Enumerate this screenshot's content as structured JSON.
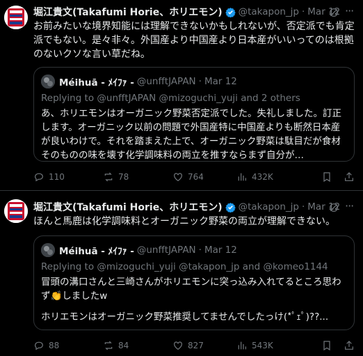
{
  "tweets": [
    {
      "author_name": "堀江貴文(Takafumi Horie、ホリエモン)",
      "handle": "@takapon_jp",
      "date": "Mar 12",
      "text": "お前みたいな境界知能には理解できないかもしれないが、否定派でも肯定派でもない。是々非々。外国産より中国産より日本産がいいってのは根拠のないクソな言い草だね。",
      "quote": {
        "author_name": "Méihuā - ﾒｲﾌｧ -",
        "handle": "@unfftJAPAN",
        "date": "Mar 12",
        "replying_prefix": "Replying to",
        "replying_to": "@unfftJAPAN @mizoguchi_yuji",
        "replying_suffix": "and 2 others",
        "text": "あ、ホリエモンはオーガニック野菜否定派でした。失礼しました。訂正します。オーガニック以前の問題で外国産特に中国産よりも断然日本産が良いわけで。それを踏まえた上で、オーガニック野菜は駄目だが食材そのものの味を壊す化学調味料の両立を推すならまず自分が…"
      },
      "stats": {
        "replies": "110",
        "reposts": "78",
        "likes": "764",
        "views": "432K"
      }
    },
    {
      "author_name": "堀江貴文(Takafumi Horie、ホリエモン)",
      "handle": "@takapon_jp",
      "date": "Mar 12",
      "text": "ほんと馬鹿は化学調味料とオーガニック野菜の両立が理解できない。",
      "quote": {
        "author_name": "Méihuā - ﾒｲﾌｧ -",
        "handle": "@unfftJAPAN",
        "date": "Mar 12",
        "replying_prefix": "Replying to",
        "replying_to": "@mizoguchi_yuji @takapon_jp",
        "replying_suffix": "and @komeo1144",
        "text_line1": "冒頭の溝口さんと三崎さんがホリエモンに突っ込み入れてるところ思わず👏しましたw",
        "text_line2": "ホリエモンはオーガニック野菜推奨してませんでしたっけ(*ﾟｪﾟ)??..."
      },
      "stats": {
        "replies": "88",
        "reposts": "84",
        "likes": "827",
        "views": "543K"
      }
    }
  ],
  "icons": [
    "verified-badge-icon",
    "grok-icon",
    "more-icon",
    "reply-icon",
    "repost-icon",
    "like-icon",
    "views-icon",
    "bookmark-icon",
    "share-icon"
  ],
  "colors": {
    "background": "#000000",
    "text": "#e7e9ea",
    "muted": "#71767b",
    "verified": "#1d9bf0",
    "border": "#2f3336"
  }
}
